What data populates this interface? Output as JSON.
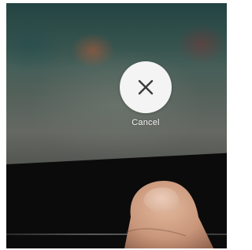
{
  "cancel_button": {
    "label": "Cancel",
    "icon": "close-icon"
  },
  "colors": {
    "button_fill": "#f4f4f4",
    "icon_stroke": "#3a3a3a",
    "label_color": "#f6f6f6",
    "bezel": "#0b0b0c",
    "skin": "#c9967a"
  }
}
